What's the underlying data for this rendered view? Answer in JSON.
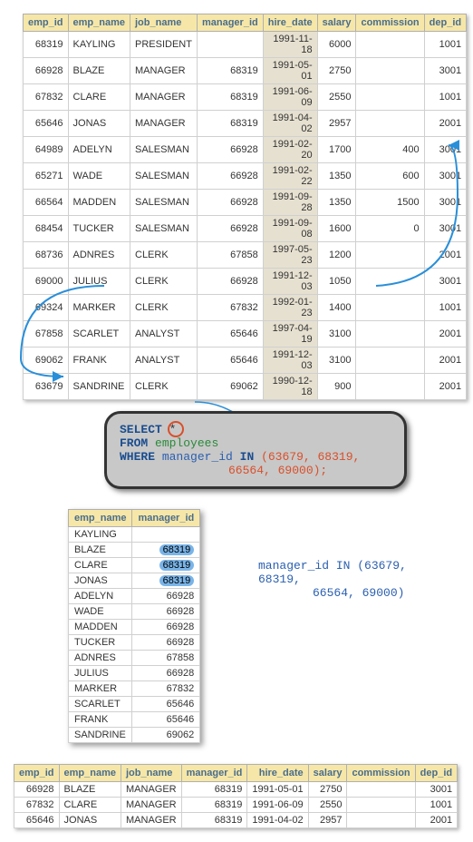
{
  "headers": [
    "emp_id",
    "emp_name",
    "job_name",
    "manager_id",
    "hire_date",
    "salary",
    "commission",
    "dep_id"
  ],
  "rows": [
    {
      "emp_id": "68319",
      "emp_name": "KAYLING",
      "job_name": "PRESIDENT",
      "manager_id": "",
      "hire_date": "1991-11-18",
      "salary": "6000",
      "commission": "",
      "dep_id": "1001"
    },
    {
      "emp_id": "66928",
      "emp_name": "BLAZE",
      "job_name": "MANAGER",
      "manager_id": "68319",
      "hire_date": "1991-05-01",
      "salary": "2750",
      "commission": "",
      "dep_id": "3001"
    },
    {
      "emp_id": "67832",
      "emp_name": "CLARE",
      "job_name": "MANAGER",
      "manager_id": "68319",
      "hire_date": "1991-06-09",
      "salary": "2550",
      "commission": "",
      "dep_id": "1001"
    },
    {
      "emp_id": "65646",
      "emp_name": "JONAS",
      "job_name": "MANAGER",
      "manager_id": "68319",
      "hire_date": "1991-04-02",
      "salary": "2957",
      "commission": "",
      "dep_id": "2001"
    },
    {
      "emp_id": "64989",
      "emp_name": "ADELYN",
      "job_name": "SALESMAN",
      "manager_id": "66928",
      "hire_date": "1991-02-20",
      "salary": "1700",
      "commission": "400",
      "dep_id": "3001"
    },
    {
      "emp_id": "65271",
      "emp_name": "WADE",
      "job_name": "SALESMAN",
      "manager_id": "66928",
      "hire_date": "1991-02-22",
      "salary": "1350",
      "commission": "600",
      "dep_id": "3001"
    },
    {
      "emp_id": "66564",
      "emp_name": "MADDEN",
      "job_name": "SALESMAN",
      "manager_id": "66928",
      "hire_date": "1991-09-28",
      "salary": "1350",
      "commission": "1500",
      "dep_id": "3001"
    },
    {
      "emp_id": "68454",
      "emp_name": "TUCKER",
      "job_name": "SALESMAN",
      "manager_id": "66928",
      "hire_date": "1991-09-08",
      "salary": "1600",
      "commission": "0",
      "dep_id": "3001"
    },
    {
      "emp_id": "68736",
      "emp_name": "ADNRES",
      "job_name": "CLERK",
      "manager_id": "67858",
      "hire_date": "1997-05-23",
      "salary": "1200",
      "commission": "",
      "dep_id": "2001"
    },
    {
      "emp_id": "69000",
      "emp_name": "JULIUS",
      "job_name": "CLERK",
      "manager_id": "66928",
      "hire_date": "1991-12-03",
      "salary": "1050",
      "commission": "",
      "dep_id": "3001"
    },
    {
      "emp_id": "69324",
      "emp_name": "MARKER",
      "job_name": "CLERK",
      "manager_id": "67832",
      "hire_date": "1992-01-23",
      "salary": "1400",
      "commission": "",
      "dep_id": "1001"
    },
    {
      "emp_id": "67858",
      "emp_name": "SCARLET",
      "job_name": "ANALYST",
      "manager_id": "65646",
      "hire_date": "1997-04-19",
      "salary": "3100",
      "commission": "",
      "dep_id": "2001"
    },
    {
      "emp_id": "69062",
      "emp_name": "FRANK",
      "job_name": "ANALYST",
      "manager_id": "65646",
      "hire_date": "1991-12-03",
      "salary": "3100",
      "commission": "",
      "dep_id": "2001"
    },
    {
      "emp_id": "63679",
      "emp_name": "SANDRINE",
      "job_name": "CLERK",
      "manager_id": "69062",
      "hire_date": "1990-12-18",
      "salary": "900",
      "commission": "",
      "dep_id": "2001"
    }
  ],
  "sql": {
    "select": "SELECT",
    "star": "*",
    "from": "FROM",
    "table": "employees",
    "where": "WHERE",
    "col": "manager_id",
    "in": "IN",
    "vals": "(63679,  68319,",
    "vals2": "66564, 69000);"
  },
  "miniHeaders": [
    "emp_name",
    "manager_id"
  ],
  "miniRows": [
    {
      "emp_name": "KAYLING",
      "manager_id": "",
      "hl": false
    },
    {
      "emp_name": "BLAZE",
      "manager_id": "68319",
      "hl": true
    },
    {
      "emp_name": "CLARE",
      "manager_id": "68319",
      "hl": true
    },
    {
      "emp_name": "JONAS",
      "manager_id": "68319",
      "hl": true
    },
    {
      "emp_name": "ADELYN",
      "manager_id": "66928",
      "hl": false
    },
    {
      "emp_name": "WADE",
      "manager_id": "66928",
      "hl": false
    },
    {
      "emp_name": "MADDEN",
      "manager_id": "66928",
      "hl": false
    },
    {
      "emp_name": "TUCKER",
      "manager_id": "66928",
      "hl": false
    },
    {
      "emp_name": "ADNRES",
      "manager_id": "67858",
      "hl": false
    },
    {
      "emp_name": "JULIUS",
      "manager_id": "66928",
      "hl": false
    },
    {
      "emp_name": "MARKER",
      "manager_id": "67832",
      "hl": false
    },
    {
      "emp_name": "SCARLET",
      "manager_id": "65646",
      "hl": false
    },
    {
      "emp_name": "FRANK",
      "manager_id": "65646",
      "hl": false
    },
    {
      "emp_name": "SANDRINE",
      "manager_id": "69062",
      "hl": false
    }
  ],
  "annotation": {
    "line1": "manager_id IN (63679,  68319,",
    "line2": "66564, 69000)"
  },
  "resultRows": [
    {
      "emp_id": "66928",
      "emp_name": "BLAZE",
      "job_name": "MANAGER",
      "manager_id": "68319",
      "hire_date": "1991-05-01",
      "salary": "2750",
      "commission": "",
      "dep_id": "3001"
    },
    {
      "emp_id": "67832",
      "emp_name": "CLARE",
      "job_name": "MANAGER",
      "manager_id": "68319",
      "hire_date": "1991-06-09",
      "salary": "2550",
      "commission": "",
      "dep_id": "1001"
    },
    {
      "emp_id": "65646",
      "emp_name": "JONAS",
      "job_name": "MANAGER",
      "manager_id": "68319",
      "hire_date": "1991-04-02",
      "salary": "2957",
      "commission": "",
      "dep_id": "2001"
    }
  ]
}
